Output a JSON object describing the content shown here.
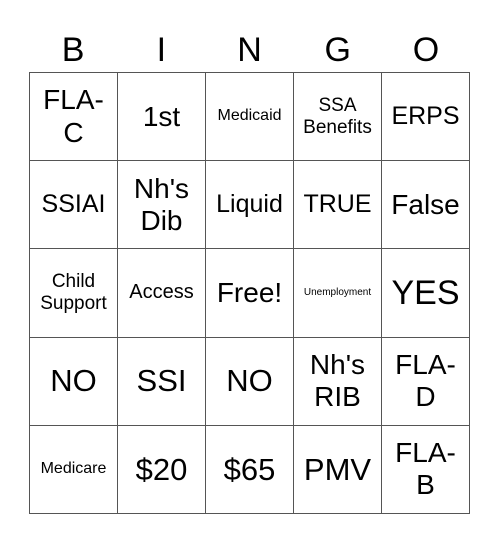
{
  "header": [
    "B",
    "I",
    "N",
    "G",
    "O"
  ],
  "cells": [
    [
      "FLA-\nC",
      "1st",
      "Medicaid",
      "SSA\nBenefits",
      "ERPS"
    ],
    [
      "SSIAI",
      "Nh's\nDib",
      "Liquid",
      "TRUE",
      "False"
    ],
    [
      "Child\nSupport",
      "Access",
      "Free!",
      "Unemployment",
      "YES"
    ],
    [
      "NO",
      "SSI",
      "NO",
      "Nh's\nRIB",
      "FLA-\nD"
    ],
    [
      "Medicare",
      "$20",
      "$65",
      "PMV",
      "FLA-\nB"
    ]
  ]
}
